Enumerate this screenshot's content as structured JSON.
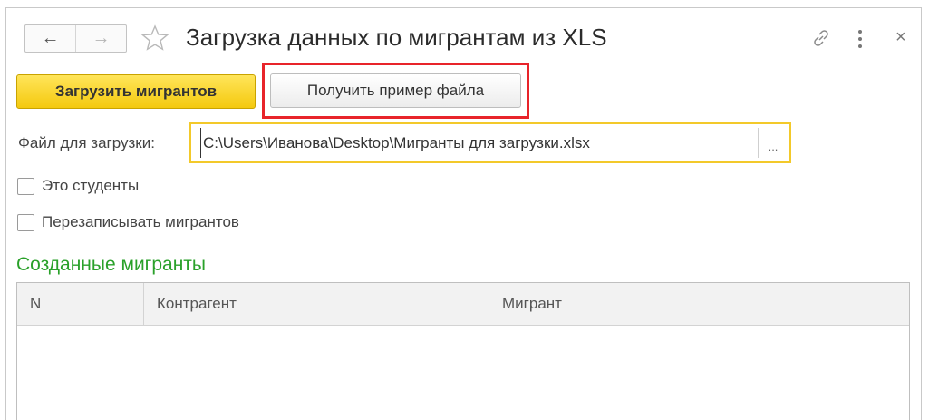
{
  "window": {
    "title": "Загрузка данных по мигрантам из XLS",
    "nav_back": "←",
    "nav_forward": "→",
    "close": "×"
  },
  "actions": {
    "load_label": "Загрузить мигрантов",
    "sample_label": "Получить пример файла"
  },
  "file": {
    "label": "Файл для загрузки:",
    "value": "C:\\Users\\Иванова\\Desktop\\Мигранты для загрузки.xlsx",
    "choose": "..."
  },
  "options": [
    {
      "label": "Это студенты",
      "checked": false
    },
    {
      "label": "Перезаписывать мигрантов",
      "checked": false
    }
  ],
  "section": {
    "title": "Созданные мигранты"
  },
  "table": {
    "columns": [
      "N",
      "Контрагент",
      "Мигрант"
    ],
    "rows": []
  },
  "colors": {
    "accent_yellow": "#f4c90e",
    "highlight_red": "#e8242a",
    "section_green": "#2aa12a"
  }
}
